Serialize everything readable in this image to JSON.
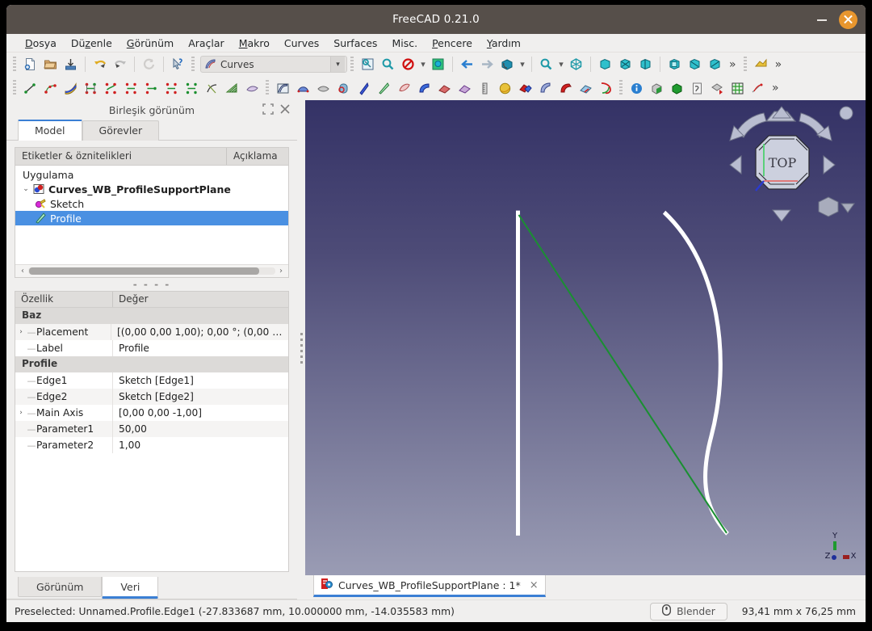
{
  "window": {
    "title": "FreeCAD 0.21.0",
    "minimize_label": "minimize",
    "close_label": "close"
  },
  "menubar": {
    "items": [
      {
        "label": "Dosya",
        "mnemonic_index": 0
      },
      {
        "label": "Düzenle",
        "mnemonic_index": 2
      },
      {
        "label": "Görünüm",
        "mnemonic_index": 0
      },
      {
        "label": "Araçlar",
        "mnemonic_index": -1
      },
      {
        "label": "Makro",
        "mnemonic_index": 0
      },
      {
        "label": "Curves",
        "mnemonic_index": -1
      },
      {
        "label": "Surfaces",
        "mnemonic_index": -1
      },
      {
        "label": "Misc.",
        "mnemonic_index": -1
      },
      {
        "label": "Pencere",
        "mnemonic_index": 0
      },
      {
        "label": "Yardım",
        "mnemonic_index": 0
      }
    ]
  },
  "toolbar": {
    "workbench_selected": "Curves",
    "overflow_label": "»",
    "row1_icons": [
      "new-document-icon",
      "open-document-icon",
      "save-document-icon",
      "undo-icon",
      "redo-icon",
      "refresh-icon",
      "whats-this-icon"
    ],
    "row1b_icons": [
      "fit-all-icon",
      "fit-selection-icon",
      "draw-style-icon",
      "axonometric-icon",
      "back-view-icon",
      "forward-view-icon",
      "isometric-view-icon",
      "zoom-icon",
      "bounding-box-icon",
      "front-view-icon",
      "top-view-icon",
      "right-view-icon",
      "rear-view-icon",
      "bottom-view-icon",
      "left-view-icon"
    ],
    "row2_icons": [
      "line-icon",
      "polyline-icon",
      "bezier-icon",
      "interpolate-icon",
      "approximate-icon",
      "discretize-icon",
      "join-curve-icon",
      "split-curve-icon",
      "blend-curve-icon",
      "parametric-arc-icon",
      "isocurve-icon",
      "sketch-on-surface-icon",
      "gordon-surface-icon",
      "sweep2rails-icon",
      "flatten-face-icon",
      "pipeshell-icon",
      "profile-support-plane-icon",
      "segment-surface-icon",
      "ruler-icon",
      "sphere-icon",
      "solid-from-shells-icon",
      "curve-on-surface-icon",
      "hooks-icon",
      "mixed-curve-icon",
      "extract-shapes-icon",
      "info-icon",
      "bounding-obj-icon",
      "solid-icon",
      "selection-view-icon",
      "adjacent-faces-icon",
      "grid-icon",
      "trim-face-icon"
    ]
  },
  "left_panel": {
    "header_title": "Birleşik görünüm",
    "header_buttons": [
      "undock-icon",
      "close-icon"
    ],
    "tabs": [
      {
        "label": "Model",
        "active": true
      },
      {
        "label": "Görevler",
        "active": false
      }
    ],
    "tree": {
      "columns": [
        "Etiketler & öznitelikleri",
        "Açıklama"
      ],
      "rows": [
        {
          "label": "Uygulama",
          "depth": 0,
          "icon": "",
          "bold": false,
          "selected": false,
          "arrow": ""
        },
        {
          "label": "Curves_WB_ProfileSupportPlane",
          "depth": 1,
          "icon": "document-icon",
          "bold": true,
          "selected": false,
          "arrow": "v"
        },
        {
          "label": "Sketch",
          "depth": 2,
          "icon": "sketch-icon",
          "bold": false,
          "selected": false,
          "arrow": ""
        },
        {
          "label": "Profile",
          "depth": 2,
          "icon": "profile-icon",
          "bold": false,
          "selected": true,
          "arrow": ""
        }
      ]
    },
    "properties": {
      "columns": [
        "Özellik",
        "Değer"
      ],
      "rows": [
        {
          "type": "group",
          "key": "Baz",
          "value": ""
        },
        {
          "type": "prop",
          "key": "Placement",
          "value": "[(0,00 0,00 1,00); 0,00 °; (0,00 m...",
          "expandable": true
        },
        {
          "type": "prop",
          "key": "Label",
          "value": "Profile",
          "expandable": false
        },
        {
          "type": "group",
          "key": "Profile",
          "value": ""
        },
        {
          "type": "prop",
          "key": "Edge1",
          "value": "Sketch [Edge1]",
          "expandable": false
        },
        {
          "type": "prop",
          "key": "Edge2",
          "value": "Sketch [Edge2]",
          "expandable": false
        },
        {
          "type": "prop",
          "key": "Main Axis",
          "value": "[0,00 0,00 -1,00]",
          "expandable": true
        },
        {
          "type": "prop",
          "key": "Parameter1",
          "value": "50,00",
          "expandable": false
        },
        {
          "type": "prop",
          "key": "Parameter2",
          "value": "1,00",
          "expandable": false
        }
      ]
    },
    "bottom_tabs": [
      {
        "label": "Görünüm",
        "active": false
      },
      {
        "label": "Veri",
        "active": true
      }
    ]
  },
  "viewport": {
    "nav_cube_label": "TOP",
    "axis_labels": {
      "x": "X",
      "y": "Y",
      "z": "Z"
    },
    "axis_colors": {
      "x": "#aa2222",
      "y": "#22aa22",
      "z": "#2222aa"
    },
    "geometry": [
      {
        "name": "sketch-edge-line",
        "color": "#ffffff",
        "kind": "line"
      },
      {
        "name": "sketch-edge-curve",
        "color": "#ffffff",
        "kind": "curve"
      },
      {
        "name": "profile-preselected-edge",
        "color": "#1a8f32",
        "kind": "line"
      }
    ]
  },
  "document_tabs": [
    {
      "label": "Curves_WB_ProfileSupportPlane  : 1*",
      "active": true,
      "close": "×",
      "icon": "freecad-doc-icon"
    }
  ],
  "statusbar": {
    "message": "Preselected: Unnamed.Profile.Edge1 (-27.833687 mm, 10.000000 mm, -14.035583 mm)",
    "nav_style": "Blender",
    "nav_icon": "mouse-icon",
    "dimensions": "93,41 mm x 76,25 mm"
  },
  "colors": {
    "titlebar": "#564f4a",
    "close_button": "#e8962e",
    "selection": "#4a90e2",
    "tab_underline": "#3b7fd4",
    "viewport_top": "#343266",
    "viewport_bottom": "#9a9cb4"
  }
}
